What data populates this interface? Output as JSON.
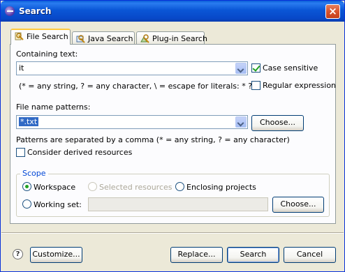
{
  "window": {
    "title": "Search"
  },
  "tabs": [
    {
      "label": "File Search",
      "active": true
    },
    {
      "label": "Java Search",
      "active": false
    },
    {
      "label": "Plug-in Search",
      "active": false
    }
  ],
  "containing_text": {
    "label": "Containing text:",
    "value": "it",
    "case_sensitive_label": "Case sensitive",
    "case_sensitive_checked": true,
    "regex_label": "Regular expression",
    "regex_checked": false,
    "hint": "(* = any string, ? = any character, \\ = escape for literals: * ? \\)"
  },
  "file_patterns": {
    "label": "File name patterns:",
    "value": "*.txt",
    "choose_label": "Choose...",
    "hint": "Patterns are separated by a comma (* = any string, ? = any character)",
    "derived_label": "Consider derived resources",
    "derived_checked": false
  },
  "scope": {
    "title": "Scope",
    "workspace_label": "Workspace",
    "selected_resources_label": "Selected resources",
    "enclosing_projects_label": "Enclosing projects",
    "working_set_label": "Working set:",
    "working_set_value": "",
    "choose_label": "Choose...",
    "selected": "workspace"
  },
  "footer": {
    "customize_label": "Customize...",
    "replace_label": "Replace...",
    "search_label": "Search",
    "cancel_label": "Cancel"
  }
}
